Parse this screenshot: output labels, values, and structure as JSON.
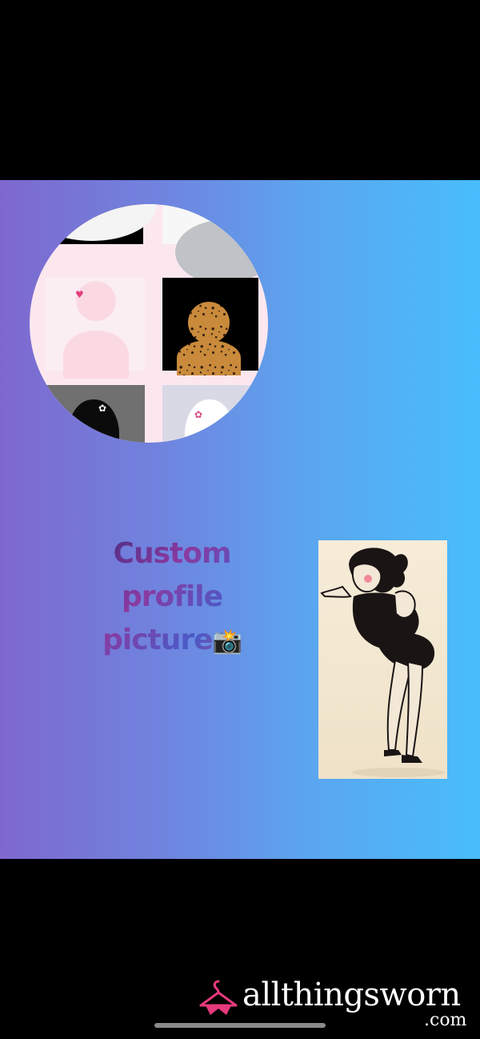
{
  "post": {
    "headline_lines": [
      "Custom",
      "profile",
      "picture"
    ],
    "headline_emoji": "📸"
  },
  "brand": {
    "name": "allthingsworn",
    "tld": ".com",
    "accent_color": "#e63a7d"
  },
  "colors": {
    "gradient_start": "#7e68cf",
    "gradient_end": "#48bdfd",
    "frame": "#000000"
  },
  "icons": [
    "hanger-logo-icon",
    "camera-flash-icon",
    "heart-icon",
    "bow-icon"
  ]
}
